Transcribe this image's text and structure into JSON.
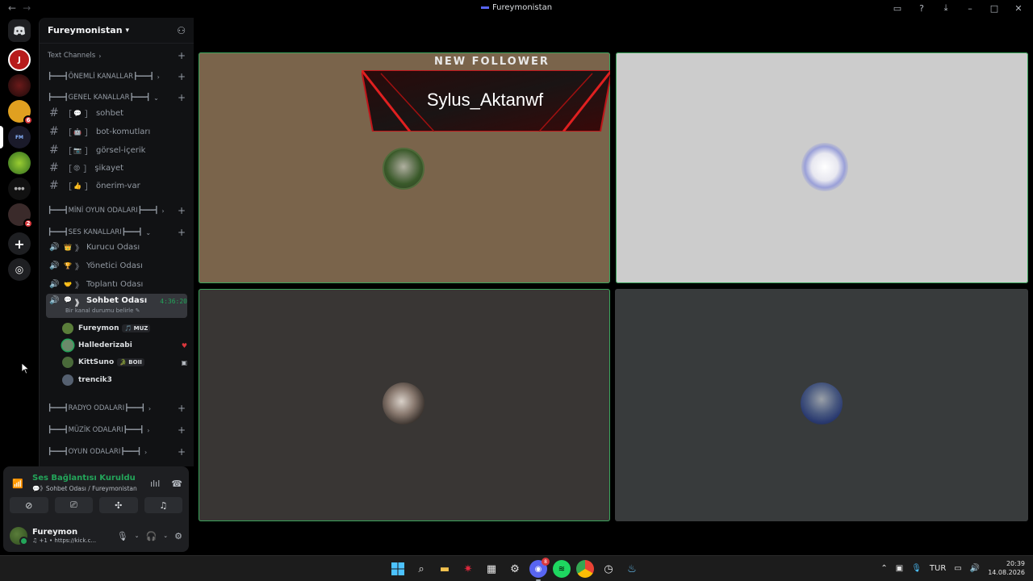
{
  "window": {
    "title": "Fureymonistan"
  },
  "server": {
    "name": "Fureymonistan"
  },
  "rail": {
    "badges": {
      "s3": "6",
      "s8": "2"
    }
  },
  "sidebar": {
    "text_channels_label": "Text Channels",
    "categories": {
      "onemli": "┣━━━┫ÖNEMLİ KANALLAR┣━━━┫",
      "genel": "┣━━━┫GENEL KANALLAR┣━━━┫",
      "mini": "┣━━━┫MİNİ OYUN ODALARI┣━━━┫",
      "ses": "┣━━━┫SES KANALLARI┣━━━┫",
      "radyo": "┣━━━┫RADYO ODALARI┣━━━┫",
      "muzik": "┣━━━┫MÜZİK ODALARI┣━━━┫",
      "oyun": "┣━━━┫OYUN ODALARI┣━━━┫"
    },
    "text_channels": [
      {
        "emoji": "💬",
        "name": "sohbet"
      },
      {
        "emoji": "🤖",
        "name": "bot-komutları"
      },
      {
        "emoji": "📷",
        "name": "görsel-içerik"
      },
      {
        "emoji": "😡",
        "name": "şikayet"
      },
      {
        "emoji": "👍",
        "name": "önerim-var"
      }
    ],
    "voice_channels": [
      {
        "emoji": "👑",
        "name": "Kurucu Odası"
      },
      {
        "emoji": "🏆",
        "name": "Yönetici Odası"
      },
      {
        "emoji": "🤝",
        "name": "Toplantı Odası"
      }
    ],
    "active_voice": {
      "emoji": "💬",
      "name": "Sohbet Odası",
      "timer": "4:36:20",
      "status": "Bir kanal durumu belirle"
    },
    "voice_users": [
      {
        "name": "Fureymon",
        "tag": "🎵 MUZ",
        "color": "#5a7d3a"
      },
      {
        "name": "Hallederizabi",
        "tag": "",
        "color": "#6a8a6a"
      },
      {
        "name": "KittSuno",
        "tag": "🐊 BOII",
        "color": "#4a6a3a"
      },
      {
        "name": "trencik3",
        "tag": "",
        "color": "#556070"
      }
    ]
  },
  "voice_panel": {
    "title": "Ses Bağlantısı Kuruldu",
    "subtitle": "💬》Sohbet Odası / Fureymonistan"
  },
  "user": {
    "name": "Fureymon",
    "status": "♫ +1 • https://kick.c..."
  },
  "stage": {
    "overlay_title": "NEW FOLLOWER",
    "follower_name": "Sylus_Aktanwf"
  },
  "taskbar": {
    "discord_badge": "8",
    "lang": "TUR",
    "time": "20:39",
    "date": "14.08.2026"
  },
  "colors": {
    "accent_green": "#23a55a",
    "tile1_bg": "#7a644b",
    "tile2_bg": "#cccccc",
    "tile3_bg": "#393634",
    "tile4_bg": "#383b3c"
  }
}
